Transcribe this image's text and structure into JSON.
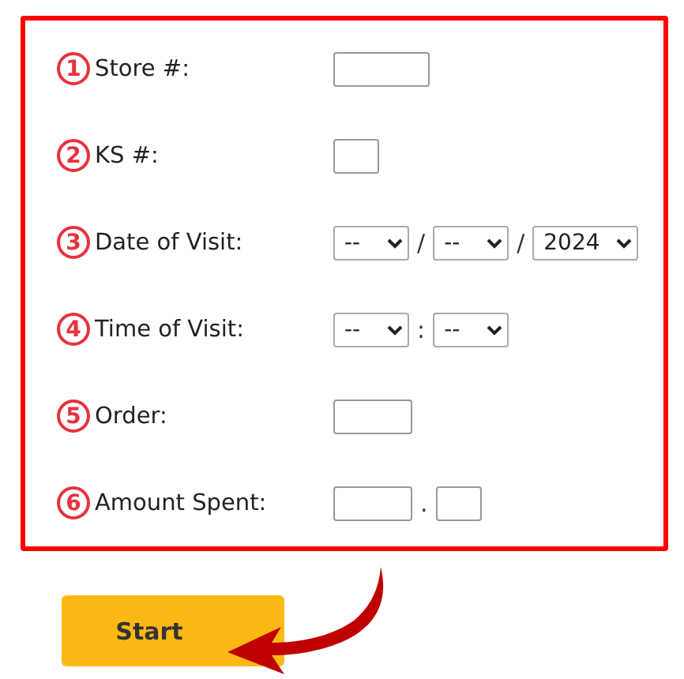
{
  "form_rows": [
    {
      "number": "1",
      "label": "Store #:",
      "controls": [
        {
          "kind": "wide"
        }
      ]
    },
    {
      "number": "2",
      "label": "KS #:",
      "controls": [
        {
          "kind": "narrow"
        }
      ]
    },
    {
      "number": "3",
      "label": "Date of Visit:",
      "controls": [
        {
          "kind": "select",
          "value": "--"
        },
        {
          "kind": "separator",
          "text": "/"
        },
        {
          "kind": "select",
          "value": "--"
        },
        {
          "kind": "separator",
          "text": "/"
        },
        {
          "kind": "select",
          "value": "2024"
        }
      ]
    },
    {
      "number": "4",
      "label": "Time of Visit:",
      "controls": [
        {
          "kind": "select",
          "value": "--"
        },
        {
          "kind": "separator",
          "text": ":"
        },
        {
          "kind": "select",
          "value": "--"
        }
      ]
    },
    {
      "number": "5",
      "label": "Order:",
      "controls": [
        {
          "kind": "medium"
        }
      ]
    },
    {
      "number": "6",
      "label": "Amount Spent:",
      "controls": [
        {
          "kind": "medium"
        },
        {
          "kind": "separator",
          "text": "."
        },
        {
          "kind": "narrow"
        }
      ]
    }
  ],
  "start_button": {
    "label": "Start"
  }
}
